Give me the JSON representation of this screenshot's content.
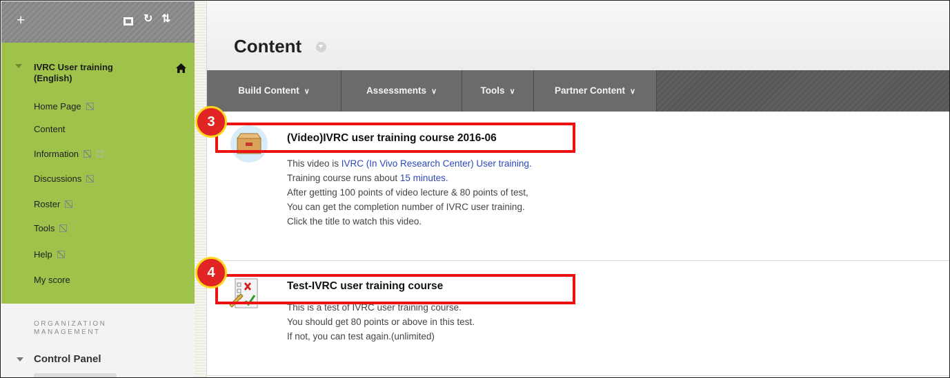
{
  "sidebar": {
    "toolbar_icons": [
      "plus-icon",
      "folder-view-icon",
      "refresh-icon",
      "sort-icon"
    ],
    "course_title": "IVRC User training (English)",
    "menu": [
      {
        "label": "Home Page",
        "hidden": true
      },
      {
        "label": "Content",
        "hidden": false
      },
      {
        "label": "Information",
        "hidden": true
      },
      {
        "label": "Discussions",
        "hidden": true
      },
      {
        "label": "Roster",
        "hidden": true
      },
      {
        "label": "Tools",
        "hidden": true
      },
      {
        "label": "Help",
        "hidden": true
      },
      {
        "label": "My score",
        "hidden": false
      }
    ],
    "org_label": "ORGANIZATION MANAGEMENT",
    "control_panel": "Control Panel"
  },
  "header": {
    "title": "Content"
  },
  "action_bar": {
    "build_content": "Build Content",
    "assessments": "Assessments",
    "tools": "Tools",
    "partner_content": "Partner Content"
  },
  "items": [
    {
      "title": "(Video)IVRC user training course 2016-06",
      "icon": "package-icon",
      "desc_1a": "This video is ",
      "desc_1_link": "IVRC (In Vivo Research Center) User training.",
      "desc_2a": "Training course runs about ",
      "desc_2_link": "15 minutes.",
      "desc_3": "After getting 100 points of video lecture & 80 points of test,",
      "desc_4": "You can get the completion number of IVRC user training.",
      "desc_5": "Click the title to watch this video."
    },
    {
      "title": "Test-IVRC user training course",
      "icon": "test-icon",
      "desc_1": "This is a test of IVRC user training course.",
      "desc_2": "You should get 80 points or above in this test.",
      "desc_3": "If not, you can test again.(unlimited)"
    }
  ],
  "annotations": {
    "badge_3": "3",
    "badge_4": "4"
  },
  "colors": {
    "sidebar_green": "#9ec24a",
    "highlight_red": "#ee1111",
    "badge_yellow": "#ffd61e",
    "link_blue": "#2b48b8"
  }
}
